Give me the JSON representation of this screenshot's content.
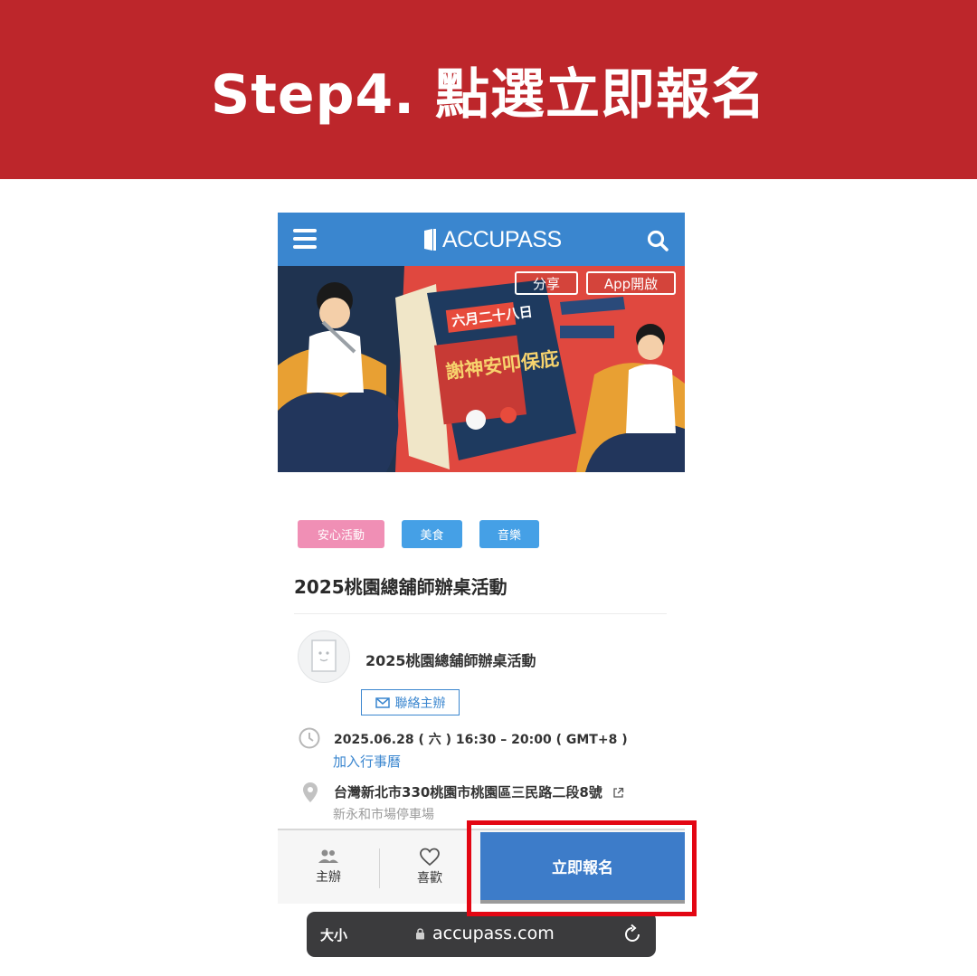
{
  "banner": {
    "title": "Step4. 點選立即報名"
  },
  "app": {
    "brand": "ACCUPASS",
    "hero_buttons": {
      "share": "分享",
      "open_app": "App開啟"
    },
    "hero_art_text": {
      "date": "六月二十八日",
      "name": "謝神安叩保庇"
    }
  },
  "event": {
    "tags": [
      "安心活動",
      "美食",
      "音樂"
    ],
    "title": "2025桃園總舖師辦桌活動",
    "organizer": {
      "name": "2025桃園總舖師辦桌活動",
      "contact_label": "聯絡主辦"
    },
    "datetime": "2025.06.28 ( 六 ) 16:30 – 20:00 ( GMT+8 )",
    "calendar_link": "加入行事曆",
    "address": "台灣新北市330桃園市桃園區三民路二段8號",
    "parking": "新永和市場停車場"
  },
  "bottom_bar": {
    "host_label": "主辦",
    "like_label": "喜歡",
    "register_label": "立即報名"
  },
  "browser": {
    "text_size": "大小",
    "url": "accupass.com"
  },
  "colors": {
    "banner": "#bd262b",
    "accent": "#3a86cf",
    "highlight": "#e30613"
  }
}
